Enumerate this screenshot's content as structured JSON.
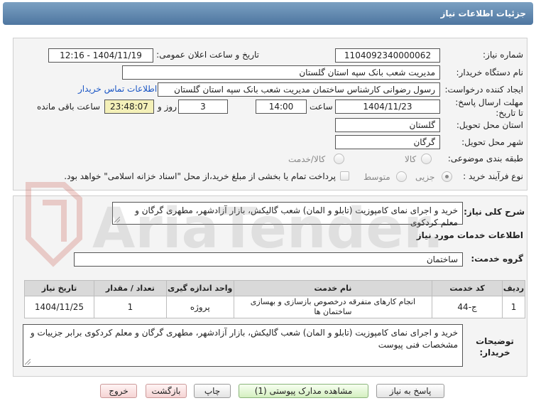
{
  "header": {
    "title": "جزئیات اطلاعات نیاز"
  },
  "form": {
    "need_number_label": "شماره نیاز:",
    "need_number": "1104092340000062",
    "announce_label": "تاریخ و ساعت اعلان عمومی:",
    "announce_value": "1404/11/19 - 12:16",
    "buyer_org_label": "نام دستگاه خریدار:",
    "buyer_org": "مدیریت شعب بانک سپه استان گلستان",
    "creator_label": "ایجاد کننده درخواست:",
    "creator": "رسول رضوانی کارشناس ساختمان مدیریت شعب بانک سپه استان گلستان",
    "contact_link": "اطلاعات تماس خریدار",
    "deadline_label": "مهلت ارسال پاسخ: تا تاریخ:",
    "deadline_date": "1404/11/23",
    "time_label": "ساعت",
    "deadline_time": "14:00",
    "days_value": "3",
    "days_label": "روز و",
    "remaining_time": "23:48:07",
    "remaining_label": "ساعت باقی مانده",
    "province_label": "استان محل تحویل:",
    "province": "گلستان",
    "city_label": "شهر محل تحویل:",
    "city": "گرگان",
    "category_label": "طبقه بندی موضوعی:",
    "category_options": [
      "کالا",
      "کالا/خدمت"
    ],
    "process_label": "نوع فرآیند خرید :",
    "process_options": [
      "جزیی",
      "متوسط"
    ],
    "payment_note": "پرداخت تمام یا بخشی از مبلغ خرید،از محل \"اسناد خزانه اسلامی\" خواهد بود."
  },
  "summary": {
    "label": "شرح کلی نیاز:",
    "value": "خرید و اجرای نمای کامپوزیت (تابلو و المان) شعب گالیکش، بازار آزادشهر، مطهری گرگان و معلم کردکوی"
  },
  "services": {
    "section_title": "اطلاعات خدمات مورد نیاز",
    "group_label": "گروه خدمت:",
    "group_value": "ساختمان",
    "columns": [
      "ردیف",
      "کد خدمت",
      "نام خدمت",
      "واحد اندازه گیری",
      "تعداد / مقدار",
      "تاریخ نیاز"
    ],
    "rows": [
      {
        "row": "1",
        "code": "ج-44",
        "name": "انجام کارهای متفرقه درخصوص بازسازی و بهسازی ساختمان ها",
        "unit": "پروژه",
        "qty": "1",
        "date": "1404/11/25"
      }
    ]
  },
  "buyer_notes": {
    "label": "توضیحات خریدار:",
    "value": "خرید و اجرای نمای کامپوزیت (تابلو و المان) شعب گالیکش، بازار آزادشهر، مطهری گرگان و معلم کردکوی برابر جزییات و مشخصات فنی پیوست"
  },
  "buttons": {
    "reply": "پاسخ به نیاز",
    "view_docs": "مشاهده مدارک پیوستی (1)",
    "print": "چاپ",
    "back": "بازگشت",
    "exit": "خروج"
  },
  "watermark": {
    "text": "AriaTender.net"
  }
}
